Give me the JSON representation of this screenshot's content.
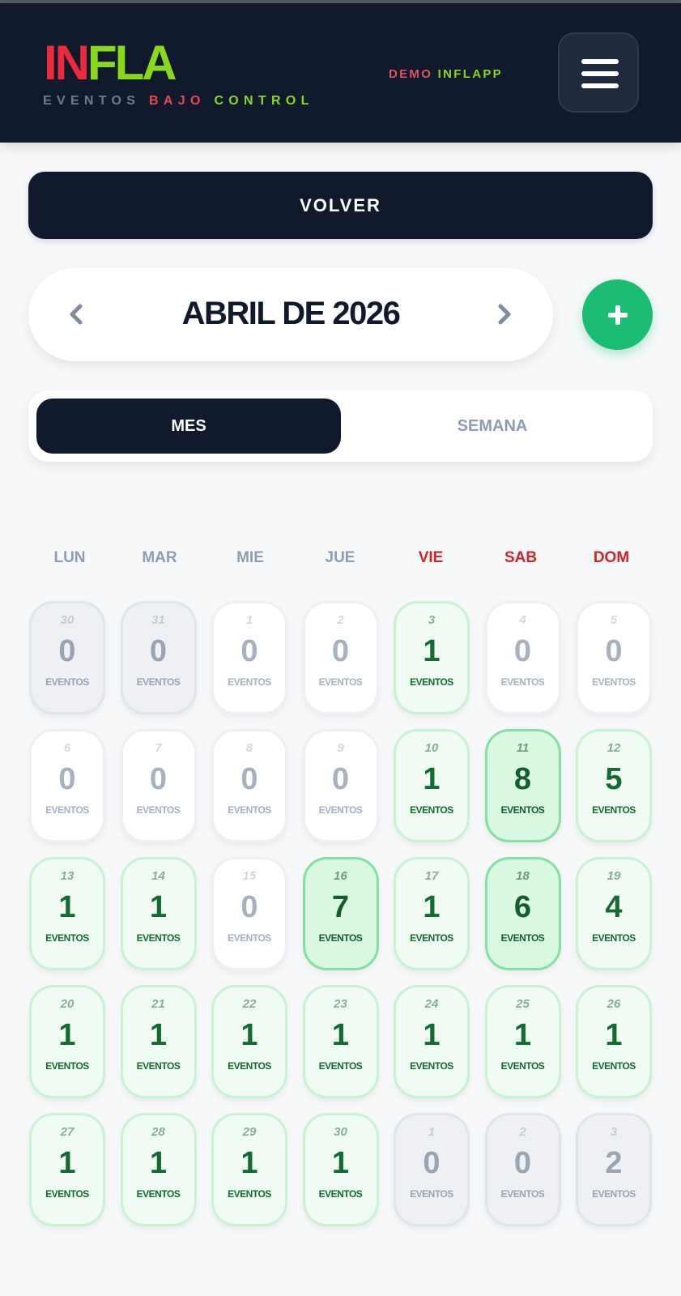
{
  "header": {
    "logo_part1": "IN",
    "logo_part2": "FLA",
    "tagline_1": "EVENTOS",
    "tagline_2": "BAJO",
    "tagline_3": "CONTROL",
    "account_part1": "DEMO",
    "account_part2": "INFLAPP",
    "menu_icon": "hamburger-menu-icon"
  },
  "actions": {
    "back_label": "VOLVER",
    "add_icon": "plus-icon"
  },
  "calendar": {
    "month_title": "ABRIL DE 2026",
    "prev_icon": "chevron-left-icon",
    "next_icon": "chevron-right-icon",
    "view_tabs": [
      "MES",
      "SEMANA"
    ],
    "active_view": "MES",
    "weekdays": [
      "LUN",
      "MAR",
      "MIE",
      "JUE",
      "VIE",
      "SAB",
      "DOM"
    ],
    "events_label": "EVENTOS",
    "days": [
      {
        "day": "30",
        "count": "0",
        "state": "grey"
      },
      {
        "day": "31",
        "count": "0",
        "state": "grey"
      },
      {
        "day": "1",
        "count": "0",
        "state": "zero"
      },
      {
        "day": "2",
        "count": "0",
        "state": "zero"
      },
      {
        "day": "3",
        "count": "1",
        "state": "green"
      },
      {
        "day": "4",
        "count": "0",
        "state": "zero"
      },
      {
        "day": "5",
        "count": "0",
        "state": "zero"
      },
      {
        "day": "6",
        "count": "0",
        "state": "zero"
      },
      {
        "day": "7",
        "count": "0",
        "state": "zero"
      },
      {
        "day": "8",
        "count": "0",
        "state": "zero"
      },
      {
        "day": "9",
        "count": "0",
        "state": "zero"
      },
      {
        "day": "10",
        "count": "1",
        "state": "green"
      },
      {
        "day": "11",
        "count": "8",
        "state": "strong"
      },
      {
        "day": "12",
        "count": "5",
        "state": "green"
      },
      {
        "day": "13",
        "count": "1",
        "state": "green"
      },
      {
        "day": "14",
        "count": "1",
        "state": "green"
      },
      {
        "day": "15",
        "count": "0",
        "state": "zero"
      },
      {
        "day": "16",
        "count": "7",
        "state": "strong"
      },
      {
        "day": "17",
        "count": "1",
        "state": "green"
      },
      {
        "day": "18",
        "count": "6",
        "state": "strong"
      },
      {
        "day": "19",
        "count": "4",
        "state": "green"
      },
      {
        "day": "20",
        "count": "1",
        "state": "green"
      },
      {
        "day": "21",
        "count": "1",
        "state": "green"
      },
      {
        "day": "22",
        "count": "1",
        "state": "green"
      },
      {
        "day": "23",
        "count": "1",
        "state": "green"
      },
      {
        "day": "24",
        "count": "1",
        "state": "green"
      },
      {
        "day": "25",
        "count": "1",
        "state": "green"
      },
      {
        "day": "26",
        "count": "1",
        "state": "green"
      },
      {
        "day": "27",
        "count": "1",
        "state": "green"
      },
      {
        "day": "28",
        "count": "1",
        "state": "green"
      },
      {
        "day": "29",
        "count": "1",
        "state": "green"
      },
      {
        "day": "30",
        "count": "1",
        "state": "green"
      },
      {
        "day": "1",
        "count": "0",
        "state": "grey"
      },
      {
        "day": "2",
        "count": "0",
        "state": "grey"
      },
      {
        "day": "3",
        "count": "2",
        "state": "grey"
      }
    ]
  },
  "colors": {
    "header_bg": "#111a2d",
    "logo_red": "#ef2a3e",
    "logo_green": "#8ad81b",
    "add_button": "#1bbd72",
    "weekend": "#d0242b",
    "event_green": "#146b32"
  }
}
